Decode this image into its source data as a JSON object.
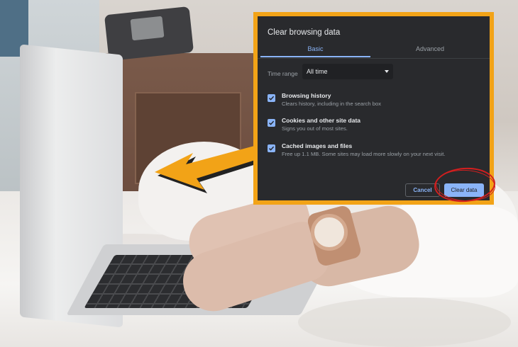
{
  "dialog": {
    "title": "Clear browsing data",
    "tabs": [
      {
        "label": "Basic",
        "selected": true
      },
      {
        "label": "Advanced",
        "selected": false
      }
    ],
    "time_range": {
      "label": "Time range",
      "value": "All time"
    },
    "items": [
      {
        "title": "Browsing history",
        "description": "Clears history, including in the search box",
        "checked": true
      },
      {
        "title": "Cookies and other site data",
        "description": "Signs you out of most sites.",
        "checked": true
      },
      {
        "title": "Cached images and files",
        "description": "Free up 1.1 MB. Some sites may load more slowly on your next visit.",
        "checked": true
      }
    ],
    "buttons": {
      "cancel": "Cancel",
      "clear": "Clear data"
    }
  },
  "colors": {
    "frame": "#f2a317",
    "dialog_bg": "#292a2d",
    "accent": "#8ab4f8",
    "highlight": "#d21f1f"
  },
  "icons": [
    "arrow-left-icon",
    "checkbox-checked-icon",
    "dropdown-caret-icon"
  ]
}
